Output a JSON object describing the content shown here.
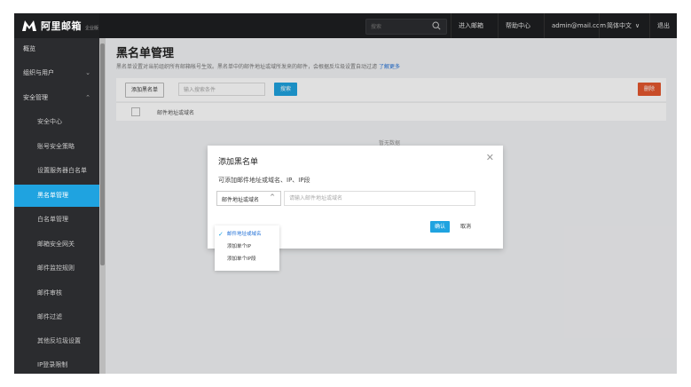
{
  "header": {
    "logo_text": "阿里邮箱",
    "logo_sub": "企业版",
    "search_placeholder": "搜索",
    "nav": [
      "进入邮箱",
      "帮助中心",
      "admin@mail.com",
      "简体中文",
      "退出"
    ]
  },
  "sidebar": {
    "items": [
      {
        "label": "概览",
        "sub": false,
        "active": false,
        "chevron": ""
      },
      {
        "label": "组织与用户",
        "sub": false,
        "active": false,
        "chevron": "⌄"
      },
      {
        "label": "安全管理",
        "sub": false,
        "active": false,
        "chevron": "⌃"
      },
      {
        "label": "安全中心",
        "sub": true,
        "active": false,
        "chevron": ""
      },
      {
        "label": "账号安全策略",
        "sub": true,
        "active": false,
        "chevron": ""
      },
      {
        "label": "设置服务器白名单",
        "sub": true,
        "active": false,
        "chevron": ""
      },
      {
        "label": "黑名单管理",
        "sub": true,
        "active": true,
        "chevron": ""
      },
      {
        "label": "白名单管理",
        "sub": true,
        "active": false,
        "chevron": ""
      },
      {
        "label": "邮箱安全网关",
        "sub": true,
        "active": false,
        "chevron": ""
      },
      {
        "label": "邮件监控规则",
        "sub": true,
        "active": false,
        "chevron": ""
      },
      {
        "label": "邮件审核",
        "sub": true,
        "active": false,
        "chevron": ""
      },
      {
        "label": "邮件过滤",
        "sub": true,
        "active": false,
        "chevron": ""
      },
      {
        "label": "其他反垃圾设置",
        "sub": true,
        "active": false,
        "chevron": ""
      },
      {
        "label": "IP登录限制",
        "sub": true,
        "active": false,
        "chevron": ""
      }
    ]
  },
  "main": {
    "title": "黑名单管理",
    "description": "黑名单设置对当前组织所有邮箱帐号生效。黑名单中的邮件地址或域所发来的邮件，会根据反垃圾设置自动过滤",
    "learn_more": "了解更多",
    "add_button": "添加黑名单",
    "search_placeholder": "输入搜索条件",
    "search_button": "搜索",
    "delete_button": "删除",
    "column_header": "邮件地址或域名",
    "empty_text": "暂无数据"
  },
  "dialog": {
    "title": "添加黑名单",
    "description": "可添加邮件地址或域名、IP、IP段",
    "select_value": "邮件地址或域名",
    "input_placeholder": "请输入邮件地址或域名",
    "ok": "确认",
    "cancel": "取消",
    "options": [
      {
        "label": "邮件地址或域名",
        "selected": true
      },
      {
        "label": "添加单个IP",
        "selected": false
      },
      {
        "label": "添加单个IP段",
        "selected": false
      }
    ]
  }
}
